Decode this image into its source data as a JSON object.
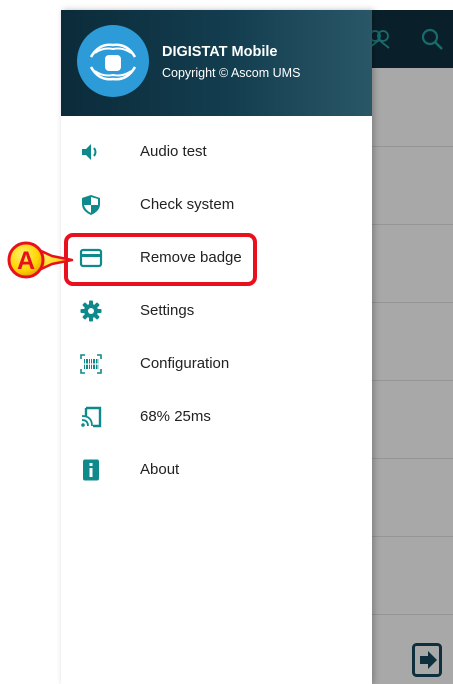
{
  "app": {
    "name": "DIGISTAT Mobile",
    "copyright": "Copyright © Ascom UMS"
  },
  "menu": {
    "items": [
      {
        "label": "Audio test",
        "icon": "speaker-icon"
      },
      {
        "label": "Check system",
        "icon": "shield-icon"
      },
      {
        "label": "Remove badge",
        "icon": "badge-card-icon"
      },
      {
        "label": "Settings",
        "icon": "gear-icon"
      },
      {
        "label": "Configuration",
        "icon": "barcode-scan-icon"
      },
      {
        "label": "68% 25ms",
        "icon": "cast-icon"
      },
      {
        "label": "About",
        "icon": "info-icon"
      }
    ]
  },
  "callout": {
    "letter": "A",
    "highlighted_item": "Remove badge"
  },
  "background_app": {
    "toolbar_icons": [
      "group-icon",
      "search-icon"
    ],
    "bottom_icon": "logout-icon"
  },
  "colors": {
    "header_dark": "#0b2b3a",
    "icon_teal": "#0e8a8c",
    "logo_blue": "#2d9bd7",
    "callout_red": "#e8101c",
    "callout_yellow": "#ffd400"
  }
}
